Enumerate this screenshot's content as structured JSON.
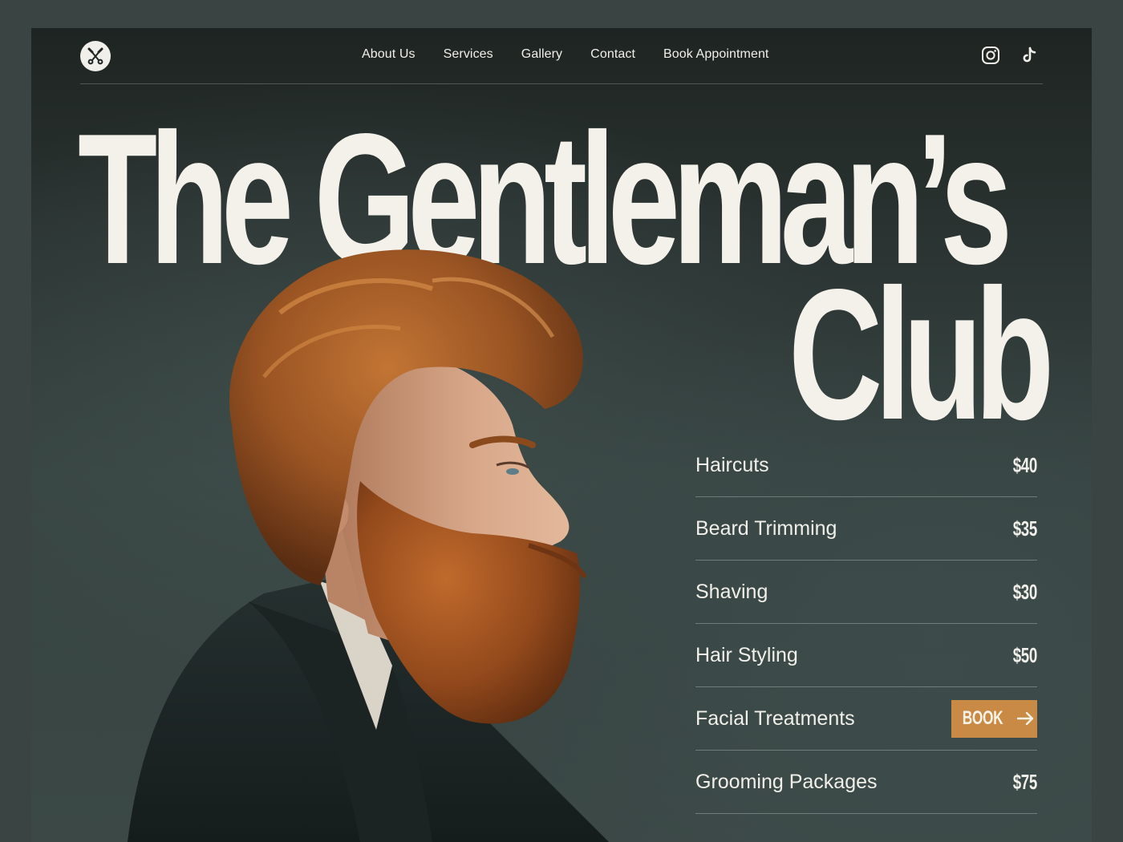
{
  "nav": {
    "links": [
      "About Us",
      "Services",
      "Gallery",
      "Contact",
      "Book Appointment"
    ]
  },
  "hero": {
    "title_line1": "The Gentleman’s",
    "title_line2": "Club"
  },
  "services": [
    {
      "name": "Haircuts",
      "price": "$40"
    },
    {
      "name": "Beard Trimming",
      "price": "$35"
    },
    {
      "name": "Shaving",
      "price": "$30"
    },
    {
      "name": "Hair Styling",
      "price": "$50"
    },
    {
      "name": "Facial Treatments",
      "action": "BOOK"
    },
    {
      "name": "Grooming Packages",
      "price": "$75"
    }
  ],
  "icons": {
    "logo": "scissors-razor-icon",
    "social": [
      "instagram-icon",
      "tiktok-icon"
    ],
    "book": "arrow-right-icon"
  },
  "colors": {
    "accent": "#c88a45",
    "text": "#f1efe9",
    "background": "#2f3a38"
  }
}
